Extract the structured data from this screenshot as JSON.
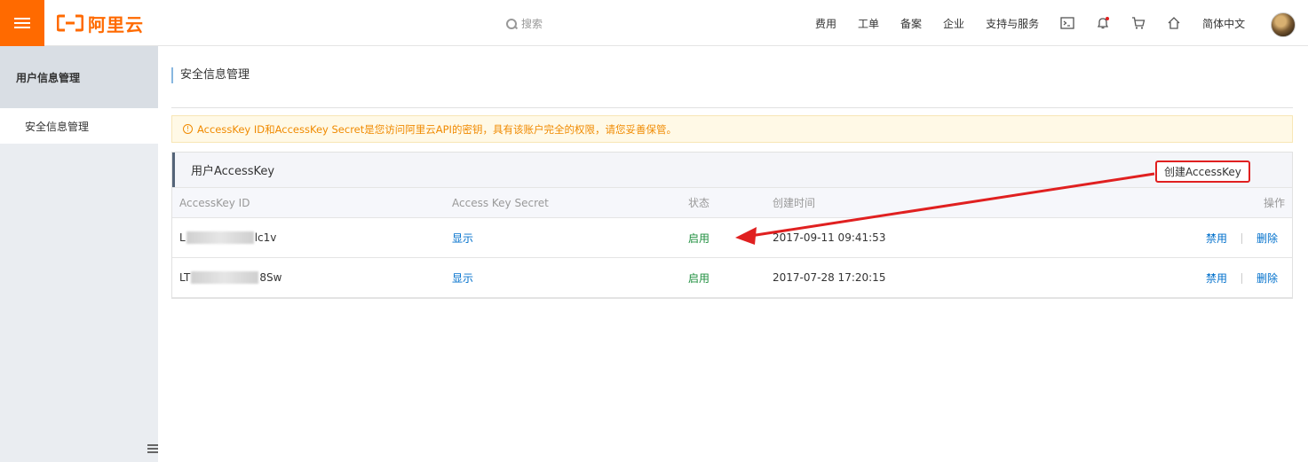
{
  "header": {
    "logo_text": "阿里云",
    "search_placeholder": "搜索",
    "nav": [
      "费用",
      "工单",
      "备案",
      "企业",
      "支持与服务"
    ],
    "language": "简体中文",
    "icons": [
      "terminal-icon",
      "bell-icon",
      "cart-icon",
      "home-icon"
    ]
  },
  "sidebar": {
    "title": "用户信息管理",
    "items": [
      {
        "label": "安全信息管理"
      }
    ]
  },
  "main": {
    "page_title": "安全信息管理",
    "alert": "AccessKey ID和AccessKey Secret是您访问阿里云API的密钥，具有该账户完全的权限，请您妥善保管。",
    "panel_title": "用户AccessKey",
    "create_button": "创建AccessKey",
    "columns": [
      "AccessKey ID",
      "Access Key Secret",
      "状态",
      "创建时间",
      "操作"
    ],
    "rows": [
      {
        "id_prefix": "L",
        "id_suffix": "lc1v",
        "secret": "显示",
        "status": "启用",
        "created": "2017-09-11 09:41:53",
        "disable": "禁用",
        "delete": "删除"
      },
      {
        "id_prefix": "LT",
        "id_suffix": "8Sw",
        "secret": "显示",
        "status": "启用",
        "created": "2017-07-28 17:20:15",
        "disable": "禁用",
        "delete": "删除"
      }
    ]
  },
  "colors": {
    "brand": "#ff6a00",
    "link": "#0070cc",
    "status_on": "#1e8e3e",
    "annotation": "#e02020"
  }
}
